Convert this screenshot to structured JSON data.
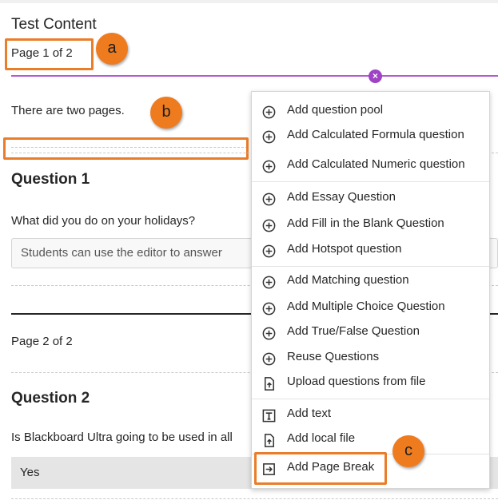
{
  "header": {
    "section_title": "Test Content",
    "page_label": "Page 1 of 2"
  },
  "callouts": {
    "a": "a",
    "b": "b",
    "c": "c"
  },
  "divider": {
    "close_glyph": "×"
  },
  "intro_text": "There are two pages.",
  "question1": {
    "title": "Question 1",
    "prompt": "What did you do on your holidays?",
    "answer_placeholder": "Students can use the editor to answer"
  },
  "page2": {
    "label": "Page 2 of 2"
  },
  "question2": {
    "title": "Question 2",
    "prompt": "Is Blackboard Ultra going to be used in all",
    "option": "Yes"
  },
  "menu": {
    "items": [
      {
        "label": "Add question pool",
        "icon": "plus-circle-icon"
      },
      {
        "label": "Add Calculated Formula question",
        "icon": "plus-circle-icon"
      },
      {
        "label": "Add Calculated Numeric question",
        "icon": "plus-circle-icon"
      },
      {
        "label": "Add Essay Question",
        "icon": "plus-circle-icon"
      },
      {
        "label": "Add Fill in the Blank Question",
        "icon": "plus-circle-icon"
      },
      {
        "label": "Add Hotspot question",
        "icon": "plus-circle-icon"
      },
      {
        "label": "Add Matching question",
        "icon": "plus-circle-icon"
      },
      {
        "label": "Add Multiple Choice Question",
        "icon": "plus-circle-icon"
      },
      {
        "label": "Add True/False Question",
        "icon": "plus-circle-icon"
      },
      {
        "label": "Reuse Questions",
        "icon": "plus-circle-icon"
      },
      {
        "label": "Upload questions from file",
        "icon": "file-upload-icon"
      },
      {
        "label": "Add text",
        "icon": "text-icon"
      },
      {
        "label": "Add local file",
        "icon": "file-upload-icon"
      },
      {
        "label": "Add Page Break",
        "icon": "page-break-icon"
      }
    ]
  },
  "colors": {
    "highlight": "#e97d2a",
    "callout": "#ef7b1f",
    "accent_purple": "#b25ad1"
  }
}
